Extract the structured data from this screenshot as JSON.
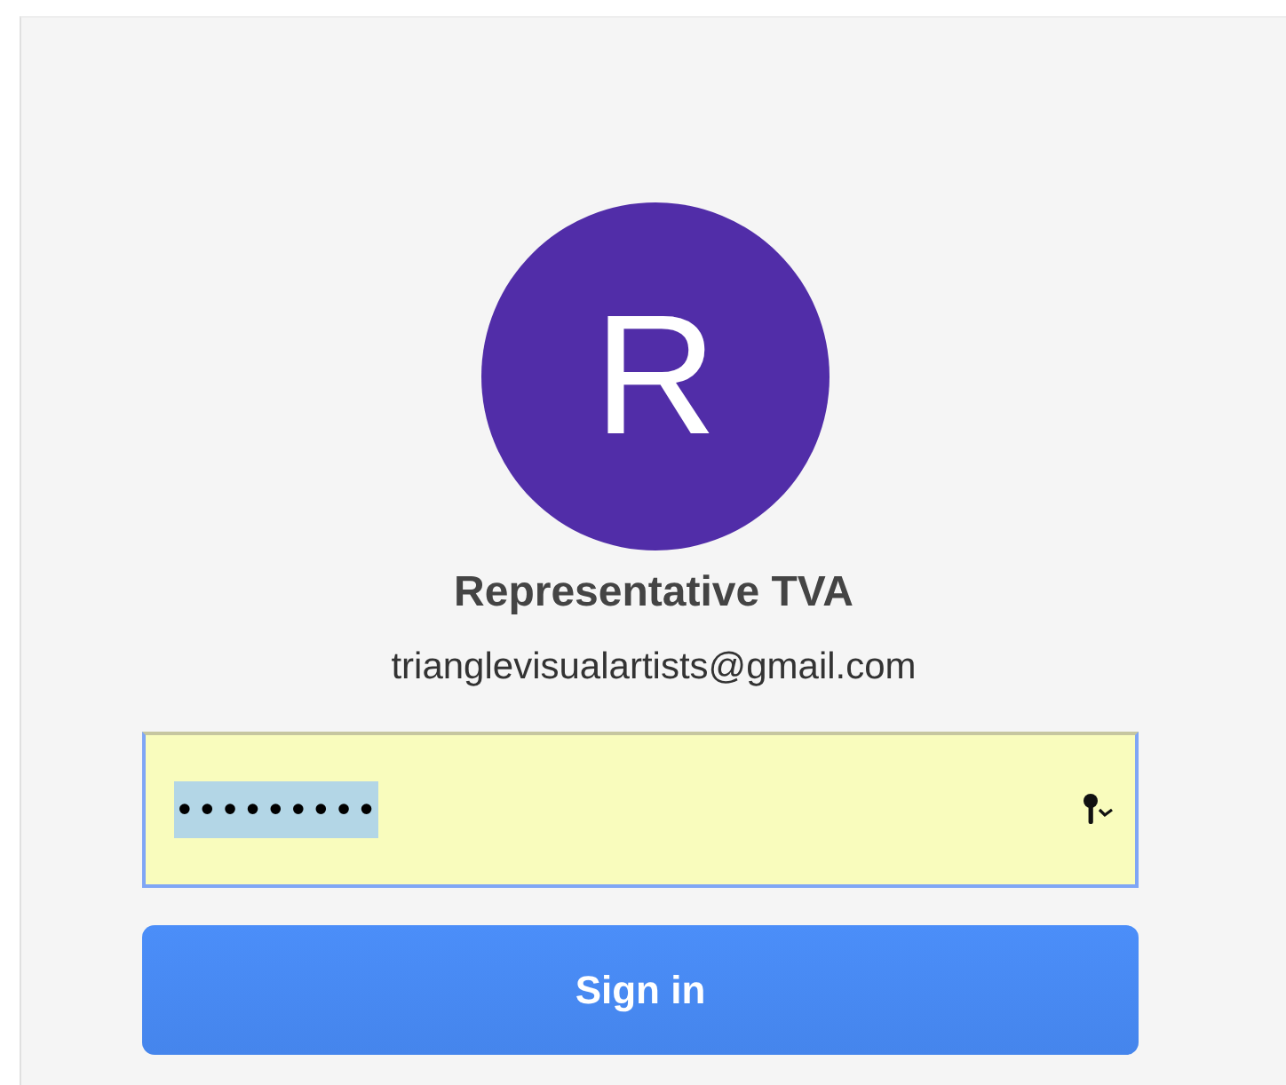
{
  "account": {
    "initial": "R",
    "name": "Representative TVA",
    "email": "trianglevisualartists@gmail.com"
  },
  "password_field": {
    "value": "•••••••••",
    "selected": true,
    "autofilled": true
  },
  "sign_in_button": {
    "label": "Sign in"
  }
}
